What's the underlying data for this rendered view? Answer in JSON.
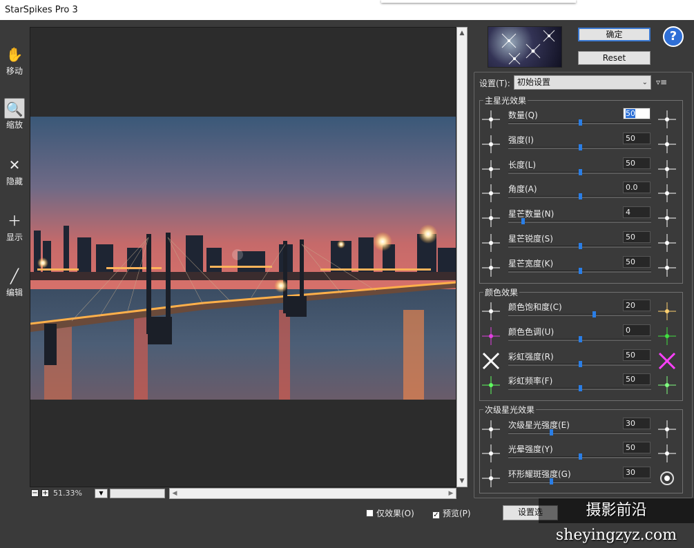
{
  "window": {
    "title": "StarSpikes Pro 3"
  },
  "tools": [
    {
      "label": "移动",
      "icon": "hand-icon"
    },
    {
      "label": "缩放",
      "icon": "magnifier-icon"
    },
    {
      "label": "隐藏",
      "icon": "cross-icon"
    },
    {
      "label": "显示",
      "icon": "plus-icon"
    },
    {
      "label": "编辑",
      "icon": "pen-icon"
    }
  ],
  "status": {
    "zoom": "51.33%"
  },
  "buttons": {
    "ok": "确定",
    "reset": "Reset",
    "help": "?"
  },
  "settings": {
    "label": "设置(T):",
    "value": "初始设置",
    "menu": "▿≡"
  },
  "groups": {
    "primary": {
      "title": "主星光效果"
    },
    "color": {
      "title": "颜色效果"
    },
    "secondary": {
      "title": "次级星光效果"
    }
  },
  "params": [
    {
      "label": "数量(Q)",
      "value": "50",
      "pos": 0.5
    },
    {
      "label": "强度(I)",
      "value": "50",
      "pos": 0.5
    },
    {
      "label": "长度(L)",
      "value": "50",
      "pos": 0.5
    },
    {
      "label": "角度(A)",
      "value": "0.0",
      "pos": 0.5
    },
    {
      "label": "星芒数量(N)",
      "value": "4",
      "pos": 0.1
    },
    {
      "label": "星芒锐度(S)",
      "value": "50",
      "pos": 0.5
    },
    {
      "label": "星芒宽度(K)",
      "value": "50",
      "pos": 0.5
    },
    {
      "label": "颜色饱和度(C)",
      "value": "20",
      "pos": 0.6
    },
    {
      "label": "颜色色调(U)",
      "value": "0",
      "pos": 0.5
    },
    {
      "label": "彩虹强度(R)",
      "value": "50",
      "pos": 0.5
    },
    {
      "label": "彩虹频率(F)",
      "value": "50",
      "pos": 0.5
    },
    {
      "label": "次级星光强度(E)",
      "value": "30",
      "pos": 0.3
    },
    {
      "label": "光晕强度(Y)",
      "value": "50",
      "pos": 0.5
    },
    {
      "label": "环形耀斑强度(G)",
      "value": "30",
      "pos": 0.3
    }
  ],
  "footer": {
    "effect_only": "仅效果(O)",
    "preview": "预览(P)",
    "preview_checked": "✓",
    "settings_btn": "设置选",
    "watermark": "摄影前沿 sheyingzyz.com"
  },
  "colors": {
    "accent": "#2a7ee6",
    "panel_bg": "#3a3a3a",
    "canvas_bg": "#2c2c2c"
  }
}
